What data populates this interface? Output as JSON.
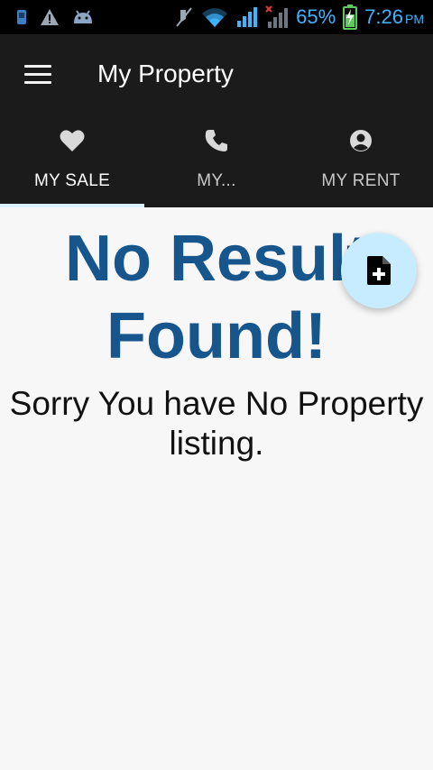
{
  "status_bar": {
    "battery_percent": "65%",
    "time": "7:26",
    "ampm": "PM",
    "accent_color": "#3eb3ff",
    "icons": [
      "sim-icon",
      "warning-icon",
      "android-icon",
      "mute-icon",
      "wifi-icon",
      "signal-icon",
      "signal-off-icon",
      "battery-charging-icon"
    ]
  },
  "app_bar": {
    "title": "My Property",
    "menu_icon": "hamburger-menu-icon",
    "background": "#1b1b1b"
  },
  "tabs": [
    {
      "label": "MY SALE",
      "icon": "heart-icon",
      "active": true
    },
    {
      "label": "MY...",
      "icon": "phone-icon",
      "active": false
    },
    {
      "label": "MY RENT",
      "icon": "person-circle-icon",
      "active": false
    }
  ],
  "content": {
    "headline": "No Result Found!",
    "message": "Sorry You have No Property listing.",
    "headline_color": "#17568d"
  },
  "fab": {
    "icon": "add-document-icon",
    "background": "#c7ecff"
  }
}
